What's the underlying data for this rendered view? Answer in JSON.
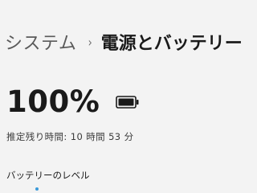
{
  "breadcrumb": {
    "parent": "システム",
    "separator": "›",
    "current": "電源とバッテリー"
  },
  "battery": {
    "percent_text": "100%",
    "level": 1.0,
    "icon": "battery-full-icon",
    "estimate_label": "推定残り時間:",
    "estimate_value": "10 時間 53 分"
  },
  "section": {
    "battery_level_title": "バッテリーのレベル"
  },
  "colors": {
    "background": "#f3f3f3",
    "text": "#1a1a1a",
    "muted": "#5a5a5a",
    "accent": "#3a9ad9"
  }
}
